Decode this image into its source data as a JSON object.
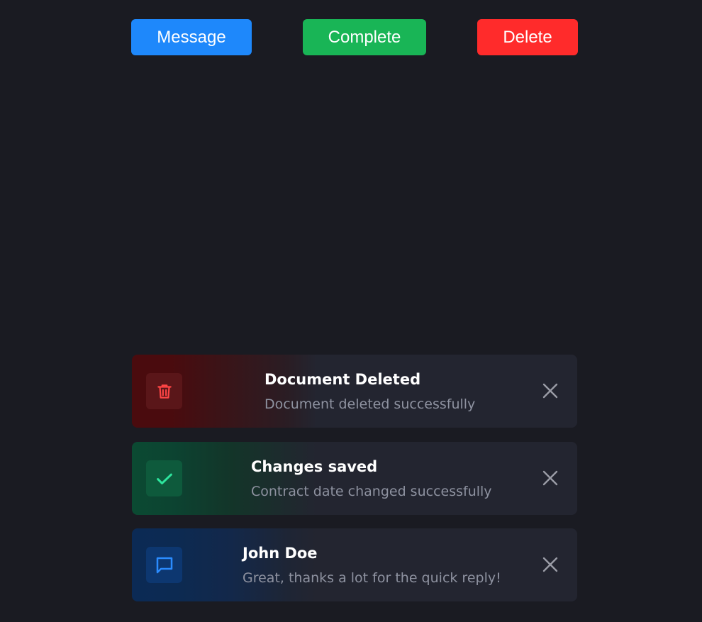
{
  "buttons": {
    "message_label": "Message",
    "complete_label": "Complete",
    "delete_label": "Delete"
  },
  "toasts": [
    {
      "type": "error",
      "icon": "trash-icon",
      "title": "Document Deleted",
      "text": "Document deleted successfully"
    },
    {
      "type": "success",
      "icon": "check-icon",
      "title": "Changes saved",
      "text": "Contract date changed successfully"
    },
    {
      "type": "message",
      "icon": "chat-bubble-icon",
      "title": "John Doe",
      "text": "Great, thanks a lot for the quick reply!"
    }
  ],
  "colors": {
    "background": "#1a1b22",
    "message": "#1e88fb",
    "complete": "#19b556",
    "delete": "#ff2b2b",
    "toast_bg": "#232530",
    "error_icon": "#ff4545",
    "success_icon": "#2ee59d",
    "message_icon": "#2b8cff",
    "close_icon": "#9a9ca6"
  }
}
